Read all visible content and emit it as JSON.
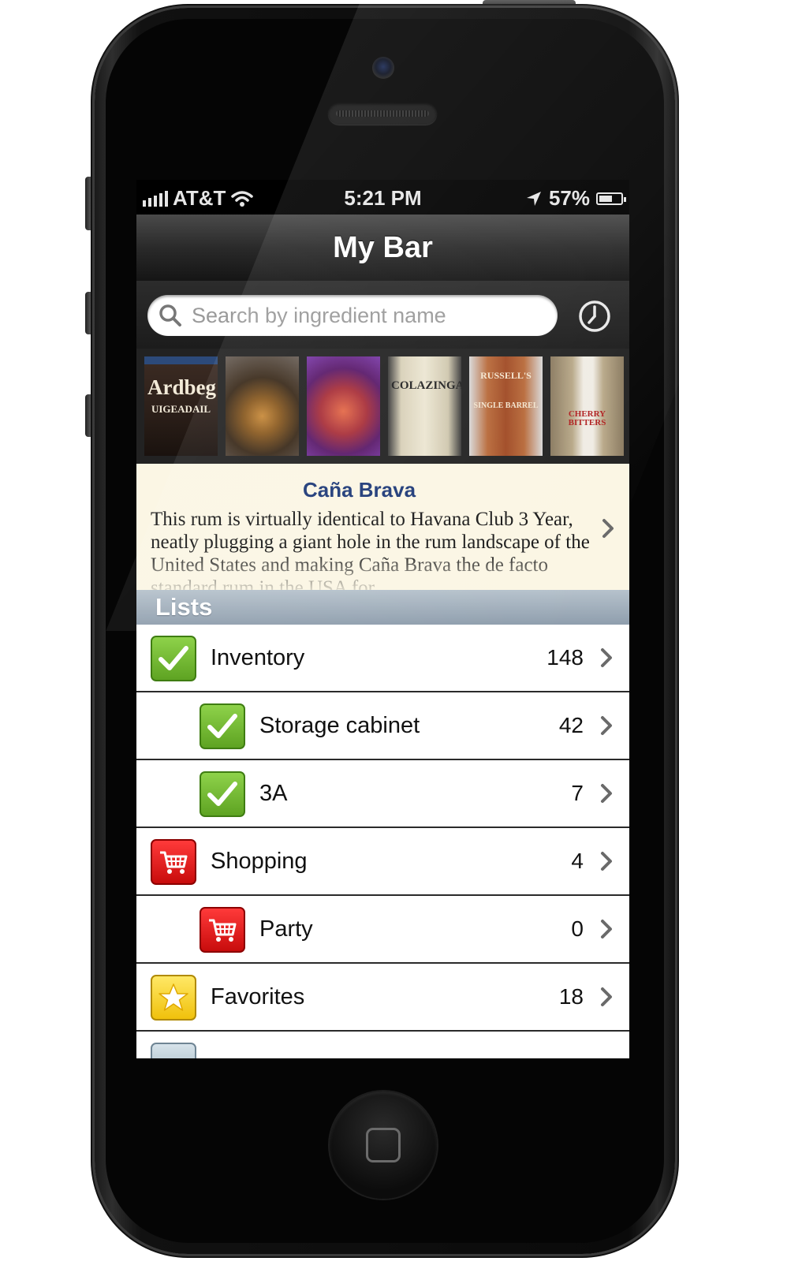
{
  "status": {
    "carrier": "AT&T",
    "time": "5:21 PM",
    "battery": "57%"
  },
  "nav": {
    "title": "My Bar"
  },
  "search": {
    "placeholder": "Search by ingredient name"
  },
  "thumbnails": [
    {
      "text": "Ardbeg",
      "sub": "UIGEADAIL"
    },
    {
      "text": "",
      "sub": ""
    },
    {
      "text": "",
      "sub": ""
    },
    {
      "text": "COLAZINGARI",
      "sub": ""
    },
    {
      "text": "RUSSELL'S",
      "sub": "SINGLE BARREL"
    },
    {
      "text": "CHERRY BITTERS",
      "sub": ""
    }
  ],
  "featured": {
    "title": "Caña Brava",
    "body": "This rum is virtually identical to Havana Club 3 Year, neatly plugging a giant hole in the rum landscape of the United States and making Caña Brava the de facto standard rum in the USA for"
  },
  "lists": {
    "header": "Lists",
    "items": [
      {
        "label": "Inventory",
        "count": "148",
        "icon": "check-icon",
        "indent": 0
      },
      {
        "label": "Storage cabinet",
        "count": "42",
        "icon": "check-icon",
        "indent": 1
      },
      {
        "label": "3A",
        "count": "7",
        "icon": "check-icon",
        "indent": 1
      },
      {
        "label": "Shopping",
        "count": "4",
        "icon": "cart-icon",
        "indent": 0
      },
      {
        "label": "Party",
        "count": "0",
        "icon": "cart-icon",
        "indent": 1
      },
      {
        "label": "Favorites",
        "count": "18",
        "icon": "star-icon",
        "indent": 0
      },
      {
        "label": "",
        "count": "",
        "icon": "flag-icon",
        "indent": 0
      }
    ]
  },
  "colors": {
    "featured_title": "#1e3a78",
    "featured_bg": "#fbf6e4",
    "section_header": "#8f9ead"
  }
}
